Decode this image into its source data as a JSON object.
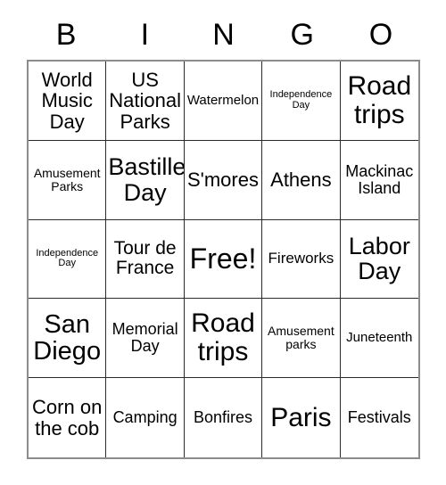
{
  "card": {
    "title": "BINGO",
    "header_letters": [
      "B",
      "I",
      "N",
      "G",
      "O"
    ],
    "columns": 5,
    "rows": 5,
    "free_space_label": "Free!",
    "free_space_position": "center",
    "border_color": "#8c8c8c",
    "grid_line_color": "#2b2b2b",
    "background_color": "#ffffff",
    "text_color": "#000000"
  },
  "grid": {
    "rows": [
      {
        "cells": [
          {
            "text": "World Music Day",
            "size": "s-lg2",
            "free": false
          },
          {
            "text": "US National Parks",
            "size": "s-lg2",
            "free": false
          },
          {
            "text": "Watermelon",
            "size": "s-sm2",
            "free": false
          },
          {
            "text": "Independence Day",
            "size": "s-xs",
            "free": false
          },
          {
            "text": "Road trips",
            "size": "s-xxl",
            "free": false
          }
        ]
      },
      {
        "cells": [
          {
            "text": "Amusement Parks",
            "size": "s-sm",
            "free": false
          },
          {
            "text": "Bastille Day",
            "size": "s-xl",
            "free": false
          },
          {
            "text": "S'mores",
            "size": "s-lg2",
            "free": false
          },
          {
            "text": "Athens",
            "size": "s-lg2",
            "free": false
          },
          {
            "text": "Mackinac Island",
            "size": "s-md2",
            "free": false
          }
        ]
      },
      {
        "cells": [
          {
            "text": "Independence Day",
            "size": "s-xs",
            "free": false
          },
          {
            "text": "Tour de France",
            "size": "s-lg",
            "free": false
          },
          {
            "text": "Free!",
            "size": "s-free",
            "free": true
          },
          {
            "text": "Fireworks",
            "size": "s-md",
            "free": false
          },
          {
            "text": "Labor Day",
            "size": "s-xl",
            "free": false
          }
        ]
      },
      {
        "cells": [
          {
            "text": "San Diego",
            "size": "s-xl2",
            "free": false
          },
          {
            "text": "Memorial Day",
            "size": "s-md2",
            "free": false
          },
          {
            "text": "Road trips",
            "size": "s-xxl",
            "free": false
          },
          {
            "text": "Amusement parks",
            "size": "s-sm",
            "free": false
          },
          {
            "text": "Juneteenth",
            "size": "s-sm2",
            "free": false
          }
        ]
      },
      {
        "cells": [
          {
            "text": "Corn on the cob",
            "size": "s-lg2",
            "free": false
          },
          {
            "text": "Camping",
            "size": "s-md2",
            "free": false
          },
          {
            "text": "Bonfires",
            "size": "s-md2",
            "free": false
          },
          {
            "text": "Paris",
            "size": "s-xxl",
            "free": false
          },
          {
            "text": "Festivals",
            "size": "s-md2",
            "free": false
          }
        ]
      }
    ]
  }
}
